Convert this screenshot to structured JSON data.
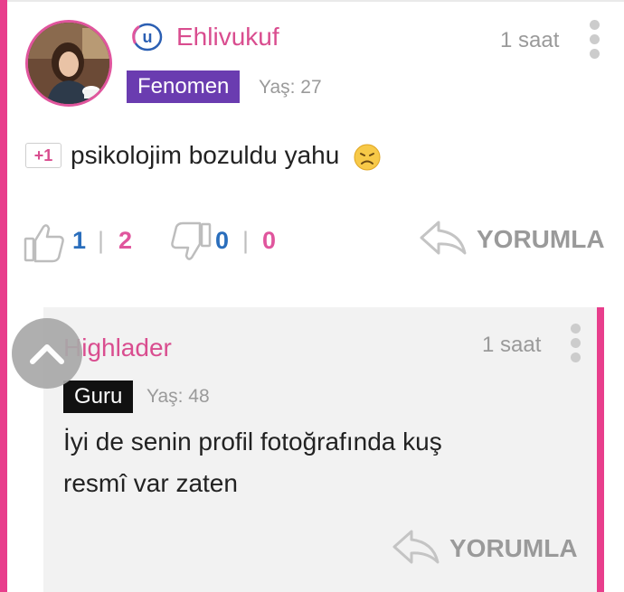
{
  "comment": {
    "username": "Ehlivukuf",
    "time": "1 saat",
    "badge": "Fenomen",
    "age": "Yaş: 27",
    "plus_tag": "+1",
    "text": "psikolojim bozuldu yahu",
    "likes_total": "1",
    "likes_other": "2",
    "dislikes_total": "0",
    "dislikes_other": "0",
    "separator": "|",
    "reply_label": "YORUMLA"
  },
  "reply": {
    "username": "Highlader",
    "time": "1 saat",
    "badge": "Guru",
    "age": "Yaş: 48",
    "text_line1": "İyi de senin profil fotoğrafında kuş",
    "text_line2": "resmî var zaten",
    "reply_label": "YORUMLA"
  },
  "colors": {
    "accent_pink": "#e83e8c",
    "username_pink": "#d94d8f",
    "fenomen_badge": "#6a3cb0",
    "guru_badge": "#111111",
    "count_blue": "#2a6ebc"
  },
  "icons": {
    "brand": "u-logo-icon",
    "more": "kebab-icon",
    "like": "thumbs-up-icon",
    "dislike": "thumbs-down-icon",
    "reply": "reply-arrow-icon",
    "scroll_top": "chevron-up-icon",
    "emoji": "disappointed-face-icon"
  }
}
